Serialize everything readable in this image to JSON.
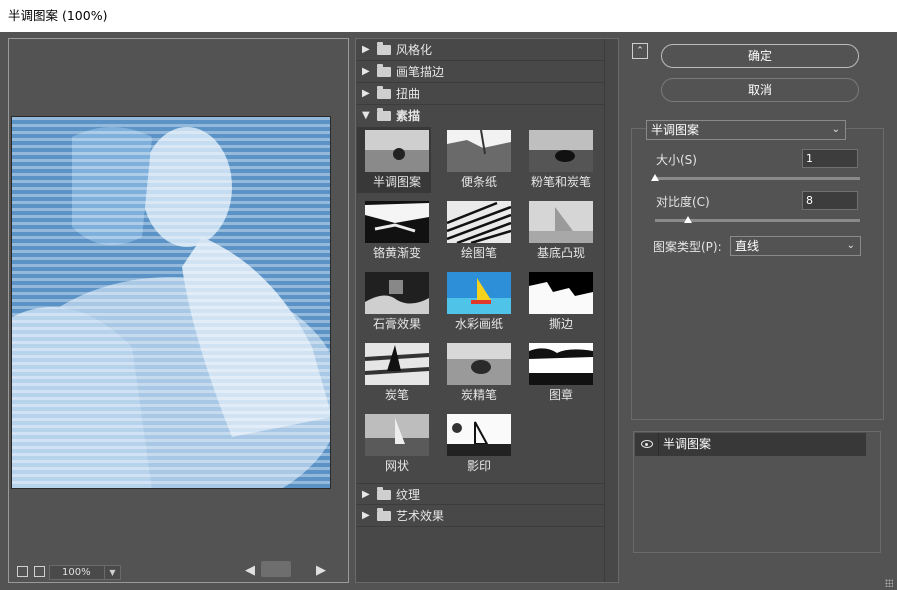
{
  "window": {
    "title": "半调图案 (100%)"
  },
  "preview": {
    "zoom": "100%"
  },
  "gallery": {
    "categories_top": [
      {
        "label": "风格化"
      },
      {
        "label": "画笔描边"
      },
      {
        "label": "扭曲"
      }
    ],
    "open_category": {
      "label": "素描"
    },
    "thumbnails": [
      {
        "label": "半调图案"
      },
      {
        "label": "便条纸"
      },
      {
        "label": "粉笔和炭笔"
      },
      {
        "label": "铬黄渐变"
      },
      {
        "label": "绘图笔"
      },
      {
        "label": "基底凸现"
      },
      {
        "label": "石膏效果"
      },
      {
        "label": "水彩画纸"
      },
      {
        "label": "撕边"
      },
      {
        "label": "炭笔"
      },
      {
        "label": "炭精笔"
      },
      {
        "label": "图章"
      },
      {
        "label": "网状"
      },
      {
        "label": "影印"
      }
    ],
    "categories_bottom": [
      {
        "label": "纹理"
      },
      {
        "label": "艺术效果"
      }
    ]
  },
  "buttons": {
    "ok": "确定",
    "cancel": "取消"
  },
  "settings": {
    "filter": "半调图案",
    "size": {
      "label": "大小(S)",
      "value": "1",
      "fraction": 0.0
    },
    "contrast": {
      "label": "对比度(C)",
      "value": "8",
      "fraction": 0.16
    },
    "pattern_type": {
      "label": "图案类型(P):",
      "value": "直线"
    }
  },
  "layers": [
    {
      "label": "半调图案"
    }
  ],
  "colors": {
    "panel": "#535353",
    "preview_blue": "#5b93c6",
    "selected": "#383838"
  }
}
